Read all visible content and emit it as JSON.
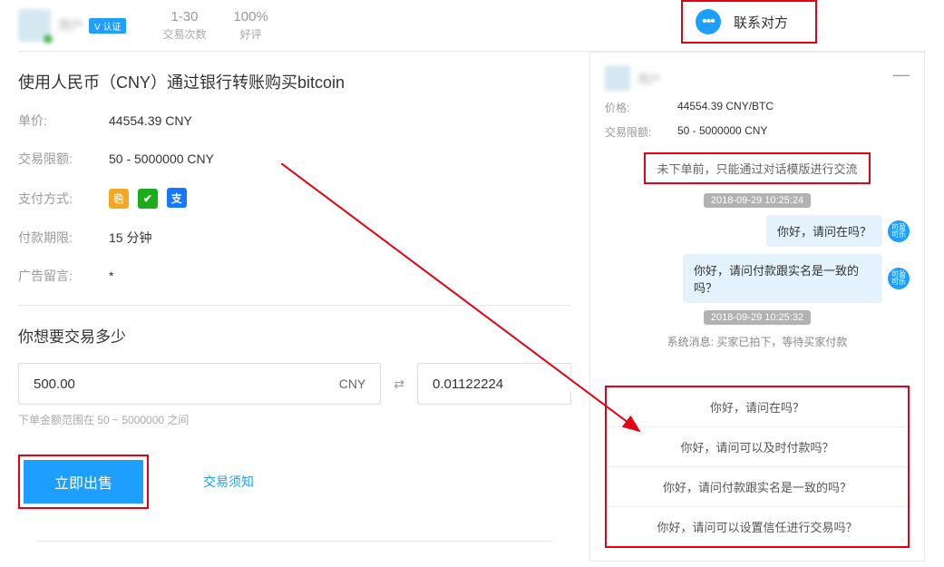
{
  "header": {
    "username": "用户",
    "verify_label": "V 认证",
    "trade_count": "1-30",
    "trade_count_label": "交易次数",
    "rating": "100%",
    "rating_label": "好评"
  },
  "contact": {
    "label": "联系对方"
  },
  "offer": {
    "title": "使用人民币（CNY）通过银行转账购买bitcoin",
    "price_label": "单价:",
    "price_value": "44554.39 CNY",
    "limit_label": "交易限额:",
    "limit_value": "50 - 5000000 CNY",
    "pay_label": "支付方式:",
    "deadline_label": "付款期限:",
    "deadline_value": "15 分钟",
    "message_label": "广告留言:",
    "message_value": "*"
  },
  "trade": {
    "subtitle": "你想要交易多少",
    "amount_fiat": "500.00",
    "fiat_unit": "CNY",
    "amount_crypto": "0.01122224",
    "hint": "下单金额范围在 50 ~ 5000000 之间",
    "sell_label": "立即出售",
    "notice_label": "交易须知"
  },
  "chat": {
    "username": "用户",
    "price_label": "价格:",
    "price_value": "44554.39 CNY/BTC",
    "limit_label": "交易限额:",
    "limit_value": "50 - 5000000 CNY",
    "warning": "未下单前，只能通过对话模版进行交流",
    "timestamps": [
      "2018-09-29 10:25:24",
      "2018-09-29 10:25:32"
    ],
    "messages": [
      "你好，请问在吗？",
      "你好，请问付款跟实名是一致的吗？"
    ],
    "avatar_text": "可盈\n可乐",
    "sys_msg": "系统消息: 买家已拍下，等待买家付款",
    "templates": [
      "你好，请问在吗？",
      "你好，请问可以及时付款吗？",
      "你好，请问付款跟实名是一致的吗？",
      "你好，请问可以设置信任进行交易吗？"
    ]
  }
}
